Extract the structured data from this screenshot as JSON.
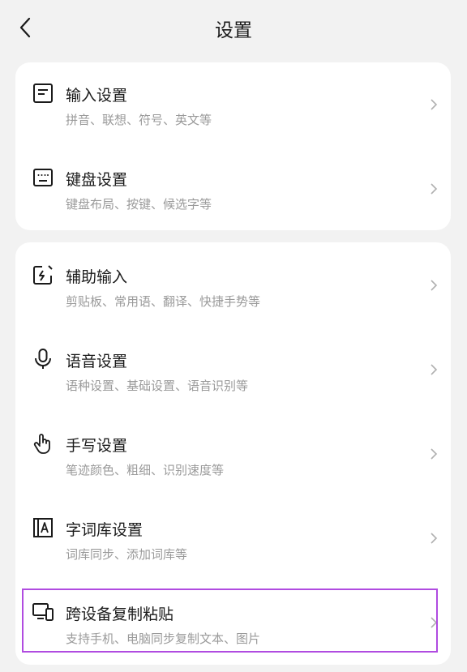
{
  "header": {
    "title": "设置"
  },
  "groups": [
    {
      "items": [
        {
          "icon": "document-lines-icon",
          "title": "输入设置",
          "subtitle": "拼音、联想、符号、英文等"
        },
        {
          "icon": "keyboard-icon",
          "title": "键盘设置",
          "subtitle": "键盘布局、按键、候选字等"
        }
      ]
    },
    {
      "items": [
        {
          "icon": "edit-lightning-icon",
          "title": "辅助输入",
          "subtitle": "剪贴板、常用语、翻译、快捷手势等"
        },
        {
          "icon": "microphone-icon",
          "title": "语音设置",
          "subtitle": "语种设置、基础设置、语音识别等"
        },
        {
          "icon": "hand-pointer-icon",
          "title": "手写设置",
          "subtitle": "笔迹颜色、粗细、识别速度等"
        },
        {
          "icon": "dictionary-book-icon",
          "title": "字词库设置",
          "subtitle": "词库同步、添加词库等"
        },
        {
          "icon": "devices-icon",
          "title": "跨设备复制粘贴",
          "subtitle": "支持手机、电脑同步复制文本、图片"
        }
      ]
    }
  ],
  "colors": {
    "highlight": "#b04be0",
    "background": "#f2f2f2",
    "card": "#ffffff"
  }
}
